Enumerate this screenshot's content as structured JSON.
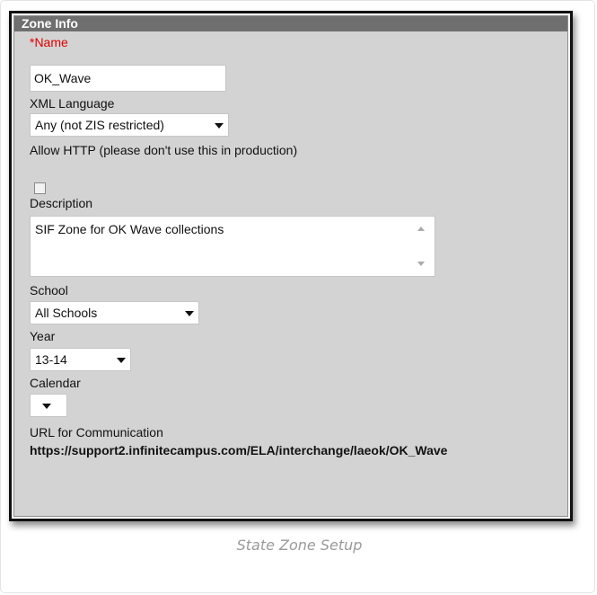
{
  "panel": {
    "title": "Zone Info"
  },
  "name": {
    "label": "*Name",
    "value": "OK_Wave"
  },
  "xml_language": {
    "label": "XML Language",
    "selected": "Any (not ZIS restricted)"
  },
  "allow_http": {
    "label": "Allow HTTP (please don't use this in production)",
    "checked": false
  },
  "description": {
    "label": "Description",
    "value": "SIF Zone for OK Wave collections"
  },
  "school": {
    "label": "School",
    "selected": "All Schools"
  },
  "year": {
    "label": "Year",
    "selected": "13-14"
  },
  "calendar": {
    "label": "Calendar",
    "selected": ""
  },
  "url": {
    "label": "URL for Communication",
    "value": "https://support2.infinitecampus.com/ELA/interchange/laeok/OK_Wave"
  },
  "caption": "State Zone Setup",
  "colors": {
    "header_bg": "#6f6f6f",
    "panel_bg": "#d3d3d3",
    "required_label": "#e00000"
  }
}
